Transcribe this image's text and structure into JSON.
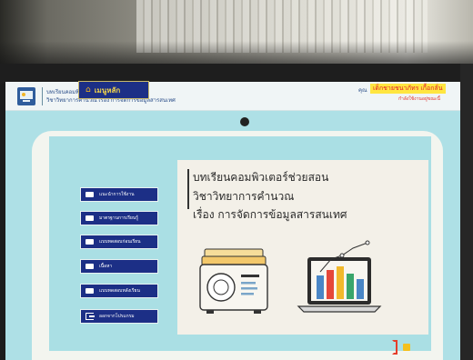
{
  "header": {
    "title_line1": "บทเรียนคอมพิวเตอร์ช่วยสอน",
    "title_line2": "วิชาวิทยาการคำนวณ เรื่อง การจัดการข้อมูลสารสนเทศ",
    "user_prefix": "คุณ",
    "user_name": "เด็กชายชนาภัทร เกื้อกลั่น",
    "user_status": "กำลังใช้งานอยู่ขณะนี้"
  },
  "menu": {
    "main_label": "เมนูหลัก",
    "items": [
      {
        "label": "แนะนำการใช้งาน",
        "icon": "book-icon"
      },
      {
        "label": "มาตรฐานการเรียนรู้",
        "icon": "book-icon"
      },
      {
        "label": "แบบทดสอบก่อนเรียน",
        "icon": "book-icon"
      },
      {
        "label": "เนื้อหา",
        "icon": "book-icon"
      },
      {
        "label": "แบบทดสอบหลังเรียน",
        "icon": "book-icon"
      },
      {
        "label": "ออกจากโปรแกรม",
        "icon": "exit-icon"
      }
    ]
  },
  "content": {
    "line1": "บทเรียนคอมพิวเตอร์ช่วยสอน",
    "line2": "วิชาวิทยาการคำนวณ",
    "line3": "เรื่อง การจัดการข้อมูลสารสนเทศ"
  },
  "colors": {
    "menu_bg": "#1c2f86",
    "menu_main_text": "#f2d54a",
    "screen_bg": "#aee0e6",
    "user_highlight": "#ffe640",
    "user_name_text": "#e0202a"
  }
}
